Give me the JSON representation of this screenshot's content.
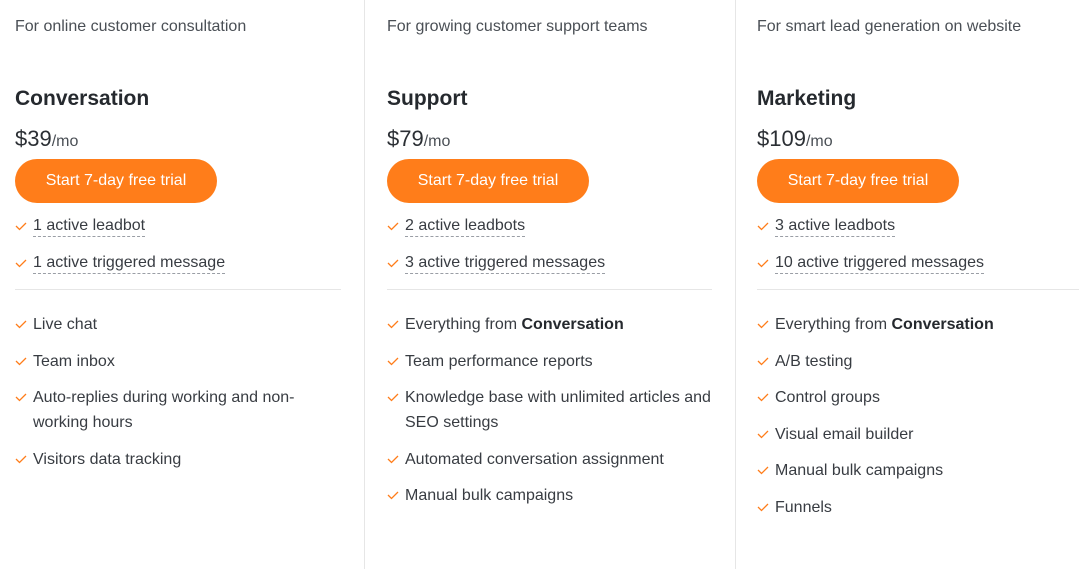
{
  "accent_color": "#ff7d1a",
  "plans": [
    {
      "tagline": "For online customer consultation",
      "name": "Conversation",
      "price": "$39",
      "period": "/mo",
      "cta_label": "Start 7-day free trial",
      "limits": [
        {
          "icon": "check-icon",
          "text": "1 active leadbot"
        },
        {
          "icon": "check-icon",
          "text": "1 active triggered message"
        }
      ],
      "features": [
        {
          "icon": "check-icon",
          "prefix": "Live chat",
          "bold": ""
        },
        {
          "icon": "check-icon",
          "prefix": "Team inbox",
          "bold": ""
        },
        {
          "icon": "check-icon",
          "prefix": "Auto-replies during working and non-working hours",
          "bold": ""
        },
        {
          "icon": "check-icon",
          "prefix": "Visitors data tracking",
          "bold": ""
        }
      ]
    },
    {
      "tagline": "For growing customer support teams",
      "name": "Support",
      "price": "$79",
      "period": "/mo",
      "cta_label": "Start 7-day free trial",
      "limits": [
        {
          "icon": "check-icon",
          "text": "2 active leadbots"
        },
        {
          "icon": "check-icon",
          "text": "3 active triggered messages"
        }
      ],
      "features": [
        {
          "icon": "check-icon",
          "prefix": "Everything from ",
          "bold": "Conversation"
        },
        {
          "icon": "check-icon",
          "prefix": "Team performance reports",
          "bold": ""
        },
        {
          "icon": "check-icon",
          "prefix": "Knowledge base with unlimited articles and SEO settings",
          "bold": ""
        },
        {
          "icon": "check-icon",
          "prefix": "Automated conversation assignment",
          "bold": ""
        },
        {
          "icon": "check-icon",
          "prefix": "Manual bulk campaigns",
          "bold": ""
        }
      ]
    },
    {
      "tagline": "For smart lead generation on website",
      "name": "Marketing",
      "price": "$109",
      "period": "/mo",
      "cta_label": "Start 7-day free trial",
      "limits": [
        {
          "icon": "check-icon",
          "text": "3 active leadbots"
        },
        {
          "icon": "check-icon",
          "text": "10 active triggered messages"
        }
      ],
      "features": [
        {
          "icon": "check-icon",
          "prefix": "Everything from ",
          "bold": "Conversation"
        },
        {
          "icon": "check-icon",
          "prefix": "A/B testing",
          "bold": ""
        },
        {
          "icon": "check-icon",
          "prefix": "Control groups",
          "bold": ""
        },
        {
          "icon": "check-icon",
          "prefix": "Visual email builder",
          "bold": ""
        },
        {
          "icon": "check-icon",
          "prefix": "Manual bulk campaigns",
          "bold": ""
        },
        {
          "icon": "check-icon",
          "prefix": "Funnels",
          "bold": ""
        }
      ]
    }
  ]
}
